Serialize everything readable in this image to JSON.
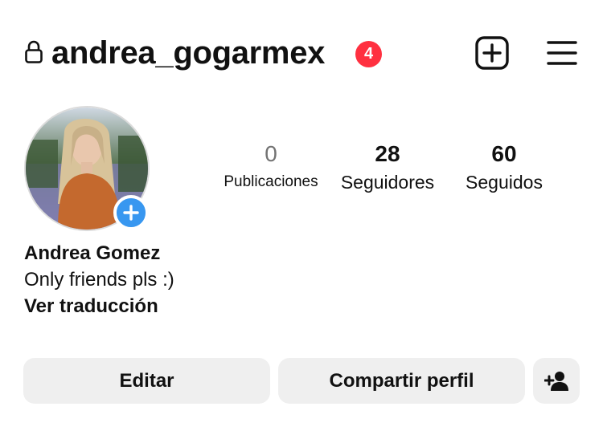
{
  "header": {
    "username": "andrea_gogarmex",
    "notification_count": "4",
    "lock_icon": "lock-icon",
    "create_icon": "plus-square-icon",
    "menu_icon": "hamburger-menu-icon"
  },
  "profile": {
    "avatar_icon": "avatar",
    "add_story_icon": "plus-icon",
    "stats": [
      {
        "value": "0",
        "label": "Publicaciones"
      },
      {
        "value": "28",
        "label": "Seguidores"
      },
      {
        "value": "60",
        "label": "Seguidos"
      }
    ],
    "name": "Andrea Gomez",
    "bio": "Only friends pls :)",
    "translate_label": "Ver traducción"
  },
  "actions": {
    "edit_label": "Editar",
    "share_label": "Compartir perfil",
    "add_user_icon": "add-person-icon"
  },
  "colors": {
    "badge": "#ff3040",
    "add_story": "#3897f0",
    "button_bg": "#efefef",
    "muted": "#737373"
  }
}
